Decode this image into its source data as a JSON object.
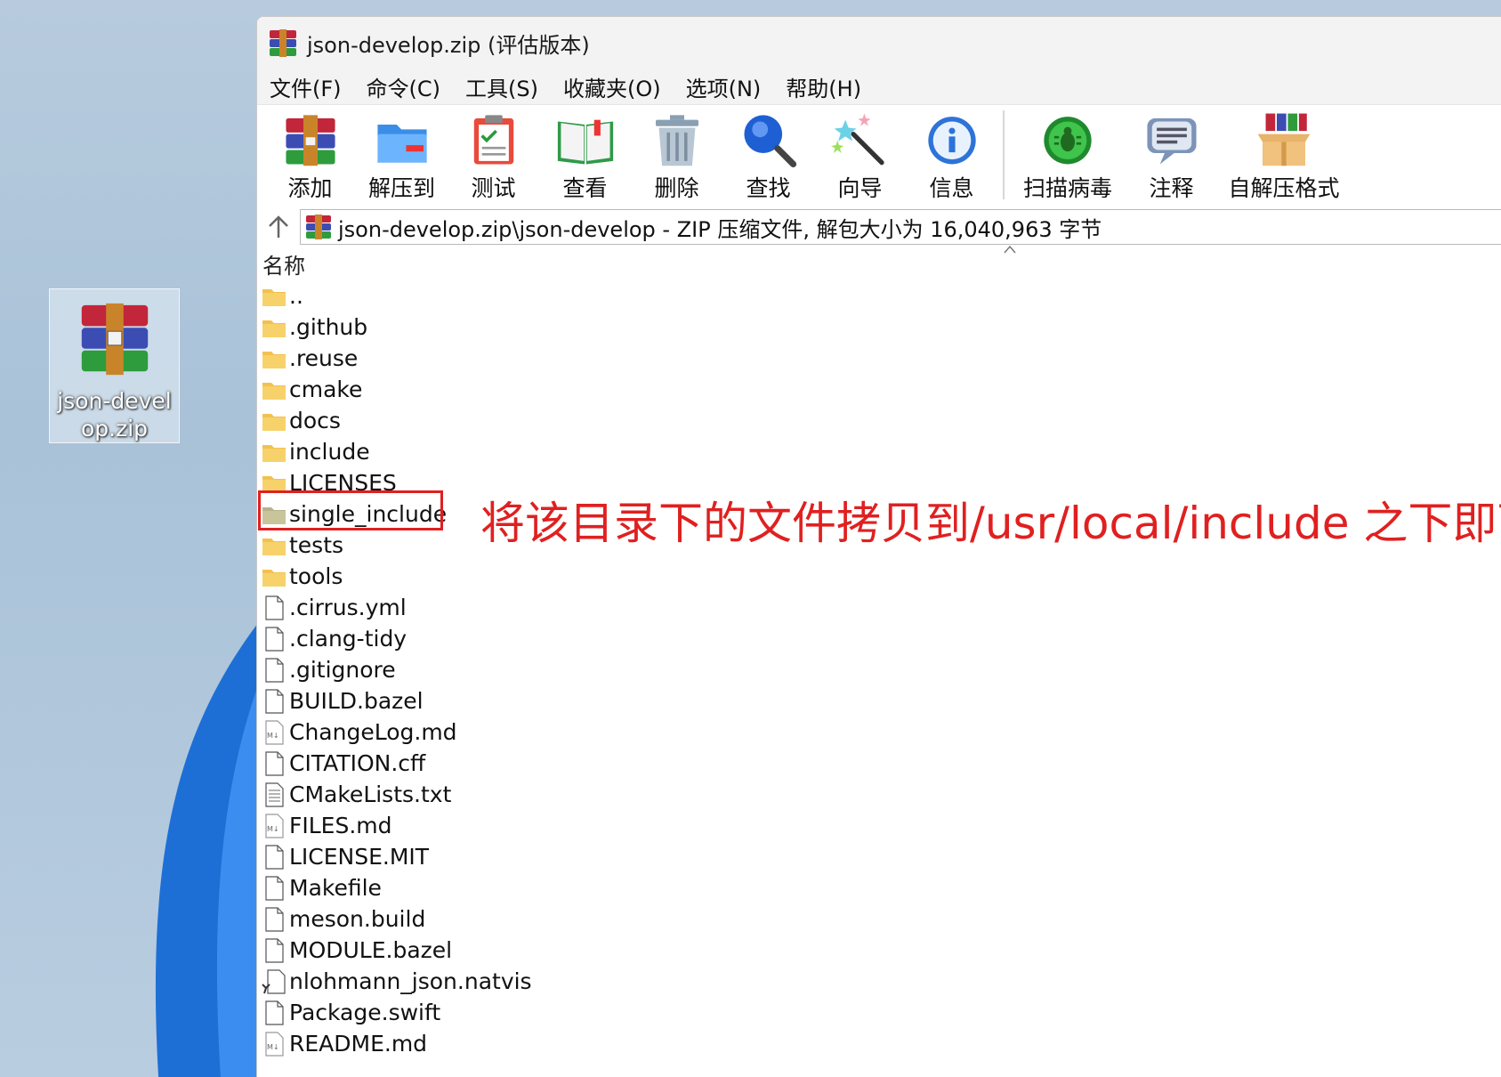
{
  "desktop": {
    "icon_label": "json-develop.zip"
  },
  "window": {
    "title": "json-develop.zip (评估版本)"
  },
  "menu": [
    {
      "label": "文件(F)"
    },
    {
      "label": "命令(C)"
    },
    {
      "label": "工具(S)"
    },
    {
      "label": "收藏夹(O)"
    },
    {
      "label": "选项(N)"
    },
    {
      "label": "帮助(H)"
    }
  ],
  "toolbar": [
    {
      "label": "添加",
      "icon": "add-archive-icon"
    },
    {
      "label": "解压到",
      "icon": "extract-to-icon"
    },
    {
      "label": "测试",
      "icon": "test-clipboard-icon"
    },
    {
      "label": "查看",
      "icon": "view-book-icon"
    },
    {
      "label": "删除",
      "icon": "trash-icon"
    },
    {
      "label": "查找",
      "icon": "find-magnifier-icon"
    },
    {
      "label": "向导",
      "icon": "wizard-wand-icon"
    },
    {
      "label": "信息",
      "icon": "info-icon"
    },
    {
      "label": "扫描病毒",
      "icon": "virus-scan-icon"
    },
    {
      "label": "注释",
      "icon": "comment-icon"
    },
    {
      "label": "自解压格式",
      "icon": "sfx-box-icon"
    }
  ],
  "path": {
    "text": "json-develop.zip\\json-develop - ZIP 压缩文件, 解包大小为 16,040,963 字节"
  },
  "columns": {
    "name": "名称"
  },
  "files": [
    {
      "name": "..",
      "type": "folder"
    },
    {
      "name": ".github",
      "type": "folder"
    },
    {
      "name": ".reuse",
      "type": "folder"
    },
    {
      "name": "cmake",
      "type": "folder"
    },
    {
      "name": "docs",
      "type": "folder"
    },
    {
      "name": "include",
      "type": "folder"
    },
    {
      "name": "LICENSES",
      "type": "folder"
    },
    {
      "name": "single_include",
      "type": "folder-selected"
    },
    {
      "name": "tests",
      "type": "folder"
    },
    {
      "name": "tools",
      "type": "folder"
    },
    {
      "name": ".cirrus.yml",
      "type": "file"
    },
    {
      "name": ".clang-tidy",
      "type": "file"
    },
    {
      "name": ".gitignore",
      "type": "file"
    },
    {
      "name": "BUILD.bazel",
      "type": "file"
    },
    {
      "name": "ChangeLog.md",
      "type": "markdown"
    },
    {
      "name": "CITATION.cff",
      "type": "file"
    },
    {
      "name": "CMakeLists.txt",
      "type": "text"
    },
    {
      "name": "FILES.md",
      "type": "markdown"
    },
    {
      "name": "LICENSE.MIT",
      "type": "file"
    },
    {
      "name": "Makefile",
      "type": "file"
    },
    {
      "name": "meson.build",
      "type": "file"
    },
    {
      "name": "MODULE.bazel",
      "type": "file"
    },
    {
      "name": "nlohmann_json.natvis",
      "type": "natvis"
    },
    {
      "name": "Package.swift",
      "type": "file"
    },
    {
      "name": "README.md",
      "type": "markdown"
    }
  ],
  "annotation": {
    "text": "将该目录下的文件拷贝到/usr/local/include 之下即可",
    "color": "#e02020"
  }
}
